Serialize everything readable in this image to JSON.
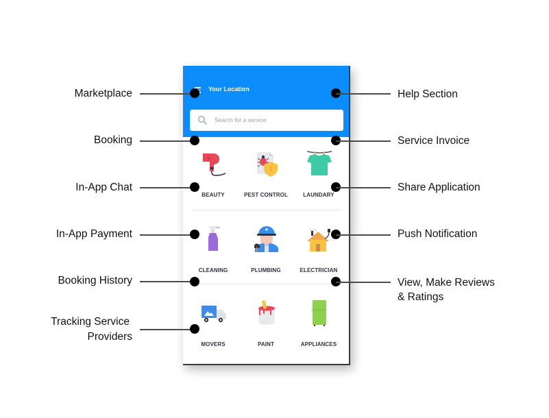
{
  "app": {
    "header": {
      "location_label": "Your Location",
      "menu_icon": "hamburger-menu-icon",
      "background_color": "#0a8cfa"
    },
    "search": {
      "placeholder": "Search for a service",
      "icon": "search-icon"
    },
    "categories": [
      {
        "label": "BEAUTY",
        "icon": "hair-dryer-icon"
      },
      {
        "label": "PEST CONTROL",
        "icon": "bug-shield-icon"
      },
      {
        "label": "LAUNDARY",
        "icon": "tshirt-hanger-icon"
      },
      {
        "label": "CLEANING",
        "icon": "spray-bottle-icon"
      },
      {
        "label": "PLUMBING",
        "icon": "plumber-icon"
      },
      {
        "label": "ELECTRICIAN",
        "icon": "house-plug-icon"
      },
      {
        "label": "MOVERS",
        "icon": "moving-truck-icon"
      },
      {
        "label": "PAINT",
        "icon": "paint-bucket-icon"
      },
      {
        "label": "APPLIANCES",
        "icon": "refrigerator-icon"
      }
    ]
  },
  "callouts": {
    "left": [
      {
        "label": "Marketplace"
      },
      {
        "label": "Booking"
      },
      {
        "label": "In-App Chat"
      },
      {
        "label": "In-App Payment"
      },
      {
        "label": "Booking History"
      },
      {
        "label_line1": "Tracking Service",
        "label_line2": "Providers"
      }
    ],
    "right": [
      {
        "label": "Help Section"
      },
      {
        "label": "Service Invoice"
      },
      {
        "label": "Share Application"
      },
      {
        "label": "Push Notification"
      },
      {
        "label_line1": "View, Make Reviews",
        "label_line2": "& Ratings"
      }
    ]
  }
}
